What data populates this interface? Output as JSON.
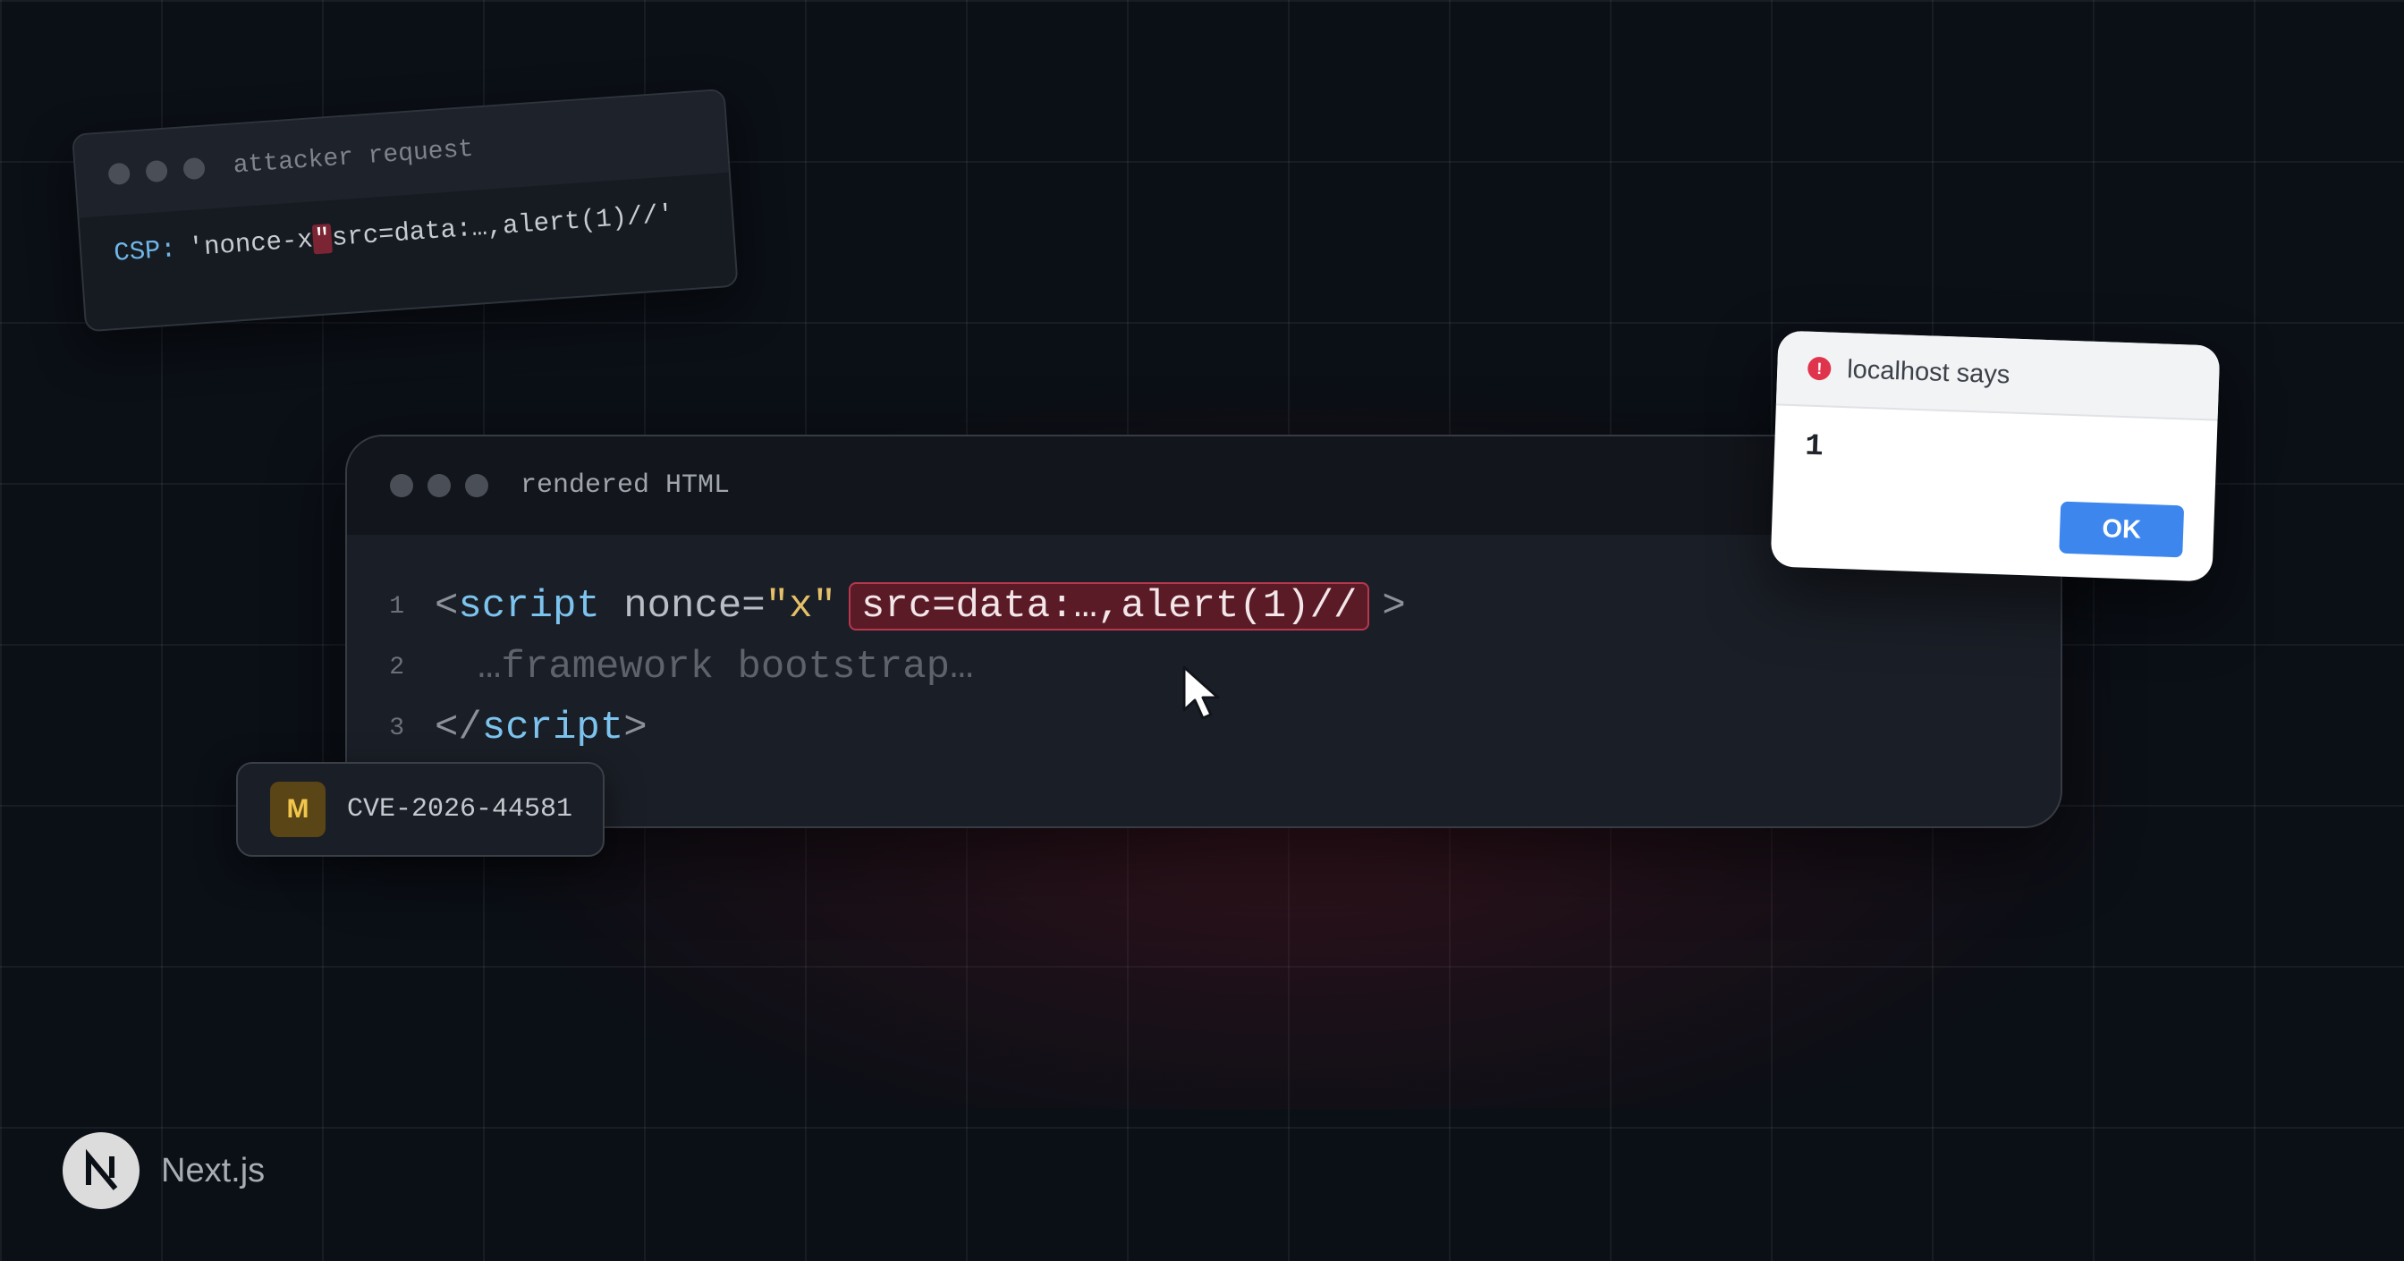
{
  "attacker_card": {
    "title": "attacker request",
    "csp_label": "CSP:",
    "value_before": "'nonce-x",
    "value_highlight": "\"",
    "value_after": "src=data:…,alert(1)//'"
  },
  "rendered_card": {
    "title": "rendered HTML",
    "lines": [
      {
        "number": "1"
      },
      {
        "number": "2",
        "text": "…framework bootstrap…"
      },
      {
        "number": "3"
      }
    ],
    "line1": {
      "open_bracket": "<",
      "tag": "script",
      "attr": " nonce=",
      "attr_value": "\"x\"",
      "injected": "src=data:…,alert(1)//",
      "close_bracket": ">"
    },
    "line3": {
      "open_bracket": "</",
      "tag": "script",
      "close_bracket": ">"
    }
  },
  "badge": {
    "letter": "M",
    "cve_id": "CVE-2026-44581"
  },
  "alert_dialog": {
    "source": "localhost says",
    "message": "1",
    "ok_label": "OK",
    "warn_glyph": "!"
  },
  "brand": {
    "name": "Next.js",
    "icon": "nextjs-logo-icon"
  },
  "colors": {
    "background": "#0b0f16",
    "injection_highlight": "#5a1a26",
    "ok_button": "#3d86ee",
    "badge_amber": "#f2c64b"
  }
}
